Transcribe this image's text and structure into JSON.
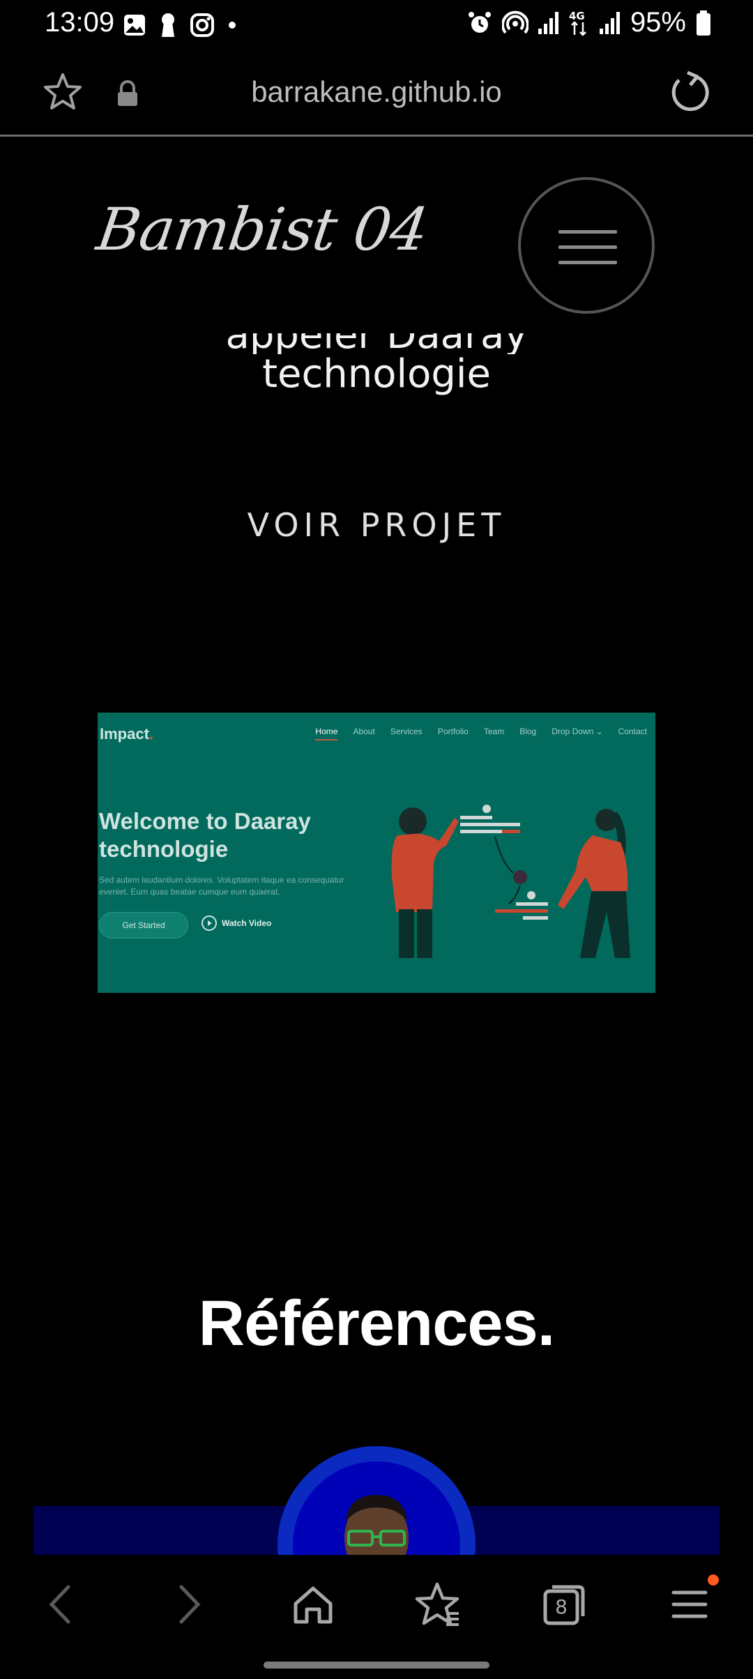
{
  "status_bar": {
    "time": "13:09",
    "battery": "95%",
    "network": "4G"
  },
  "browser": {
    "url": "barrakane.github.io"
  },
  "site": {
    "brand": "Bambist 04",
    "project_title_line1": "appeler Daaray",
    "project_title_line2": "technologie",
    "view_project": "VOIR PROJET",
    "references_title": "Références."
  },
  "preview": {
    "logo": "Impact",
    "logo_dot": ".",
    "nav": [
      "Home",
      "About",
      "Services",
      "Portfolio",
      "Team",
      "Blog",
      "Drop Down",
      "Contact"
    ],
    "hero_line1": "Welcome to Daaray",
    "hero_line2": "technologie",
    "subtitle": "Sed autem laudantium dolores. Voluptatem itaque ea consequatur eveniet. Eum quas beatae cumque eum quaerat.",
    "get_started": "Get Started",
    "watch_video": "Watch Video",
    "colors": {
      "background": "#016a5c",
      "accent": "#c55a3b"
    }
  },
  "bottom_nav": {
    "tabs_count": "8"
  }
}
